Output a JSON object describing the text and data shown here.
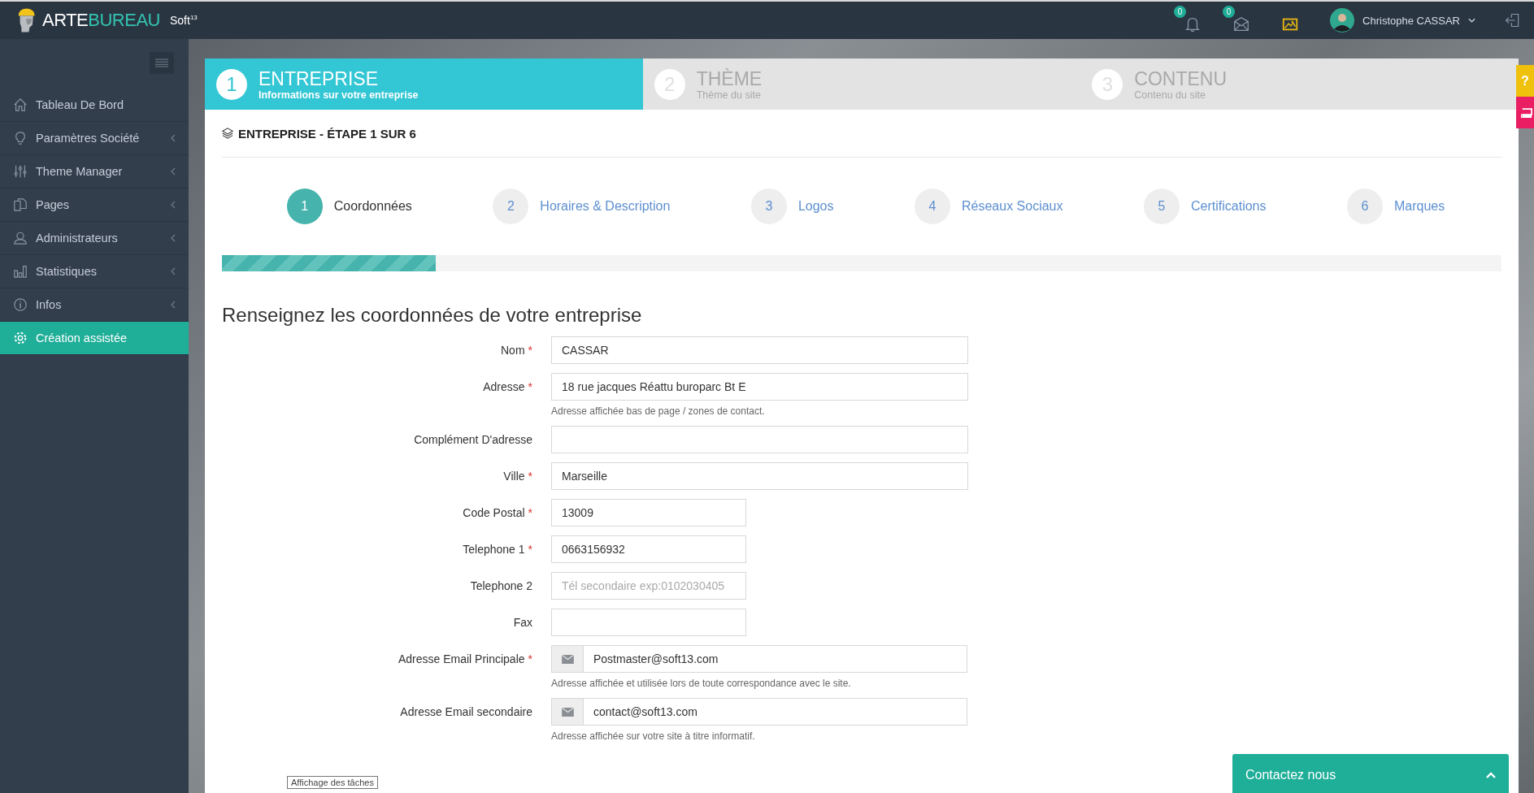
{
  "header": {
    "logo": {
      "part_1": "ARTE",
      "part_2": "BUREAU",
      "suffix": "Soft",
      "suffix_mark": "13"
    },
    "notifications": [
      {
        "kind": "bell",
        "count": "0"
      },
      {
        "kind": "mail",
        "count": "0"
      },
      {
        "kind": "image"
      }
    ],
    "user": {
      "name": "Christophe CASSAR"
    }
  },
  "sidebar": {
    "items": [
      {
        "label": "Tableau De Bord",
        "has_submenu": false,
        "selected": false
      },
      {
        "label": "Paramètres Société",
        "has_submenu": true,
        "selected": false
      },
      {
        "label": "Theme Manager",
        "has_submenu": true,
        "selected": false
      },
      {
        "label": "Pages",
        "has_submenu": true,
        "selected": false
      },
      {
        "label": "Administrateurs",
        "has_submenu": true,
        "selected": false
      },
      {
        "label": "Statistiques",
        "has_submenu": true,
        "selected": false
      },
      {
        "label": "Infos",
        "has_submenu": true,
        "selected": false
      },
      {
        "label": "Création assistée",
        "has_submenu": false,
        "selected": true
      }
    ]
  },
  "wizard_tabs": [
    {
      "number": "1",
      "title": "ENTREPRISE",
      "subtitle": "Informations sur votre entreprise",
      "selected": true
    },
    {
      "number": "2",
      "title": "THÈME",
      "subtitle": "Thème du site",
      "selected": false
    },
    {
      "number": "3",
      "title": "CONTENU",
      "subtitle": "Contenu du site",
      "selected": false
    }
  ],
  "section_title": "ENTREPRISE - ÉTAPE 1 SUR 6",
  "steps": [
    {
      "number": "1",
      "label": "Coordonnées",
      "selected": true
    },
    {
      "number": "2",
      "label": "Horaires & Description",
      "selected": false
    },
    {
      "number": "3",
      "label": "Logos",
      "selected": false
    },
    {
      "number": "4",
      "label": "Réseaux Sociaux",
      "selected": false
    },
    {
      "number": "5",
      "label": "Certifications",
      "selected": false
    },
    {
      "number": "6",
      "label": "Marques",
      "selected": false
    }
  ],
  "progress": {
    "level": 0.167
  },
  "form": {
    "title": "Renseignez les coordonnées de votre entreprise",
    "fields": [
      {
        "kind": "wide",
        "label": "Nom",
        "required_mark": "*",
        "value": "CASSAR"
      },
      {
        "kind": "wide",
        "label": "Adresse",
        "required_mark": "*",
        "value": "18 rue jacques Réattu buroparc Bt E",
        "help": "Adresse affichée bas de page / zones de contact."
      },
      {
        "kind": "wide",
        "label": "Complément D'adresse"
      },
      {
        "kind": "wide",
        "label": "Ville",
        "required_mark": "*",
        "value": "Marseille"
      },
      {
        "kind": "short",
        "label": "Code Postal",
        "required_mark": "*",
        "value": "13009"
      },
      {
        "kind": "short",
        "label": "Telephone 1",
        "required_mark": "*",
        "value": "0663156932"
      },
      {
        "kind": "short",
        "label": "Telephone 2",
        "placeholder": "Tél secondaire exp:0102030405"
      },
      {
        "kind": "short",
        "label": "Fax"
      },
      {
        "kind": "email",
        "label": "Adresse Email Principale",
        "required_mark": "*",
        "value": "Postmaster@soft13.com",
        "help": "Adresse affichée et utilisée lors de toute correspondance avec le site."
      },
      {
        "kind": "email",
        "label": "Adresse Email secondaire",
        "value": "contact@soft13.com",
        "help": "Adresse affichée sur votre site à titre informatif."
      }
    ]
  },
  "side_tabs": {
    "help_label": "?"
  },
  "contact": {
    "label": "Contactez nous"
  },
  "tooltip": "Affichage des tâches"
}
